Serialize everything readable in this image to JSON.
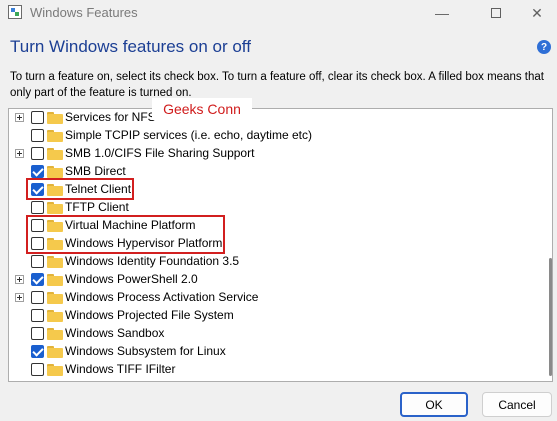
{
  "window": {
    "title": "Windows Features",
    "icons": {
      "app": "windows-features-icon",
      "minimize": "minimize-icon",
      "maximize": "maximize-icon",
      "close": "close-icon"
    },
    "minimize_glyph": "—",
    "close_glyph": "✕"
  },
  "header": {
    "heading": "Turn Windows features on or off",
    "help_glyph": "?",
    "description": "To turn a feature on, select its check box. To turn a feature off, clear its check box. A filled box means that only part of the feature is turned on."
  },
  "watermark": {
    "text": "Geeks Conn"
  },
  "features": [
    {
      "label": "Services for NFS",
      "expandable": true,
      "checked": false
    },
    {
      "label": "Simple TCPIP services (i.e. echo, daytime etc)",
      "expandable": false,
      "checked": false
    },
    {
      "label": "SMB 1.0/CIFS File Sharing Support",
      "expandable": true,
      "checked": false
    },
    {
      "label": "SMB Direct",
      "expandable": false,
      "checked": true
    },
    {
      "label": "Telnet Client",
      "expandable": false,
      "checked": true
    },
    {
      "label": "TFTP Client",
      "expandable": false,
      "checked": false
    },
    {
      "label": "Virtual Machine Platform",
      "expandable": false,
      "checked": false
    },
    {
      "label": "Windows Hypervisor Platform",
      "expandable": false,
      "checked": false
    },
    {
      "label": "Windows Identity Foundation 3.5",
      "expandable": false,
      "checked": false
    },
    {
      "label": "Windows PowerShell 2.0",
      "expandable": true,
      "checked": true
    },
    {
      "label": "Windows Process Activation Service",
      "expandable": true,
      "checked": false
    },
    {
      "label": "Windows Projected File System",
      "expandable": false,
      "checked": false
    },
    {
      "label": "Windows Sandbox",
      "expandable": false,
      "checked": false
    },
    {
      "label": "Windows Subsystem for Linux",
      "expandable": false,
      "checked": true
    },
    {
      "label": "Windows TIFF IFilter",
      "expandable": false,
      "checked": false
    }
  ],
  "colors": {
    "accent": "#1a5fcf",
    "heading": "#1c3f94",
    "highlight": "#d21f1f"
  },
  "buttons": {
    "ok": "OK",
    "cancel": "Cancel"
  }
}
